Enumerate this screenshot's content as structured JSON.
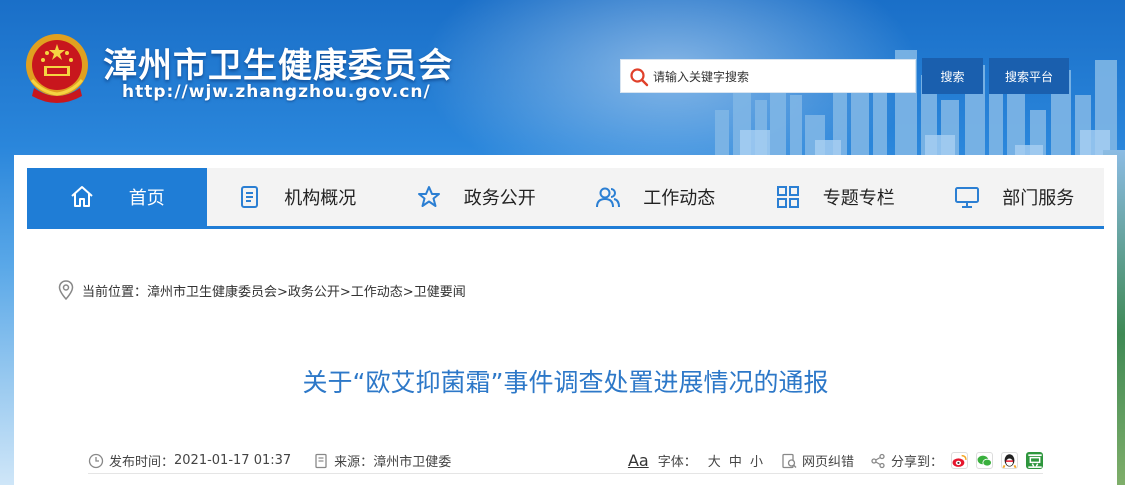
{
  "header": {
    "site_title": "漳州市卫生健康委员会",
    "site_url": "http://wjw.zhangzhou.gov.cn/",
    "search": {
      "placeholder": "请输入关键字搜索",
      "search_button": "搜索",
      "platform_button": "搜索平台"
    }
  },
  "nav": {
    "items": [
      {
        "label": "首页",
        "icon": "home-icon",
        "active": true
      },
      {
        "label": "机构概况",
        "icon": "document-icon",
        "active": false
      },
      {
        "label": "政务公开",
        "icon": "star-icon",
        "active": false
      },
      {
        "label": "工作动态",
        "icon": "users-icon",
        "active": false
      },
      {
        "label": "专题专栏",
        "icon": "grid-icon",
        "active": false
      },
      {
        "label": "部门服务",
        "icon": "monitor-icon",
        "active": false
      }
    ]
  },
  "breadcrumb": {
    "prefix": "当前位置：",
    "path": "漳州市卫生健康委员会>政务公开>工作动态>卫健要闻"
  },
  "article": {
    "title": "关于“欧艾抑菌霜”事件调查处置进展情况的通报",
    "publish_label": "发布时间：",
    "publish_time": "2021-01-17 01:37",
    "source_label": "来源：",
    "source": "漳州市卫健委",
    "font_icon_text": "Aa",
    "font_label": "字体：",
    "font_sizes": "大 中 小",
    "correction_label": "网页纠错",
    "share_label": "分享到："
  },
  "colors": {
    "nav_active": "#1f7dd6",
    "title_blue": "#2d78c8",
    "button_blue": "#1a5fae"
  }
}
